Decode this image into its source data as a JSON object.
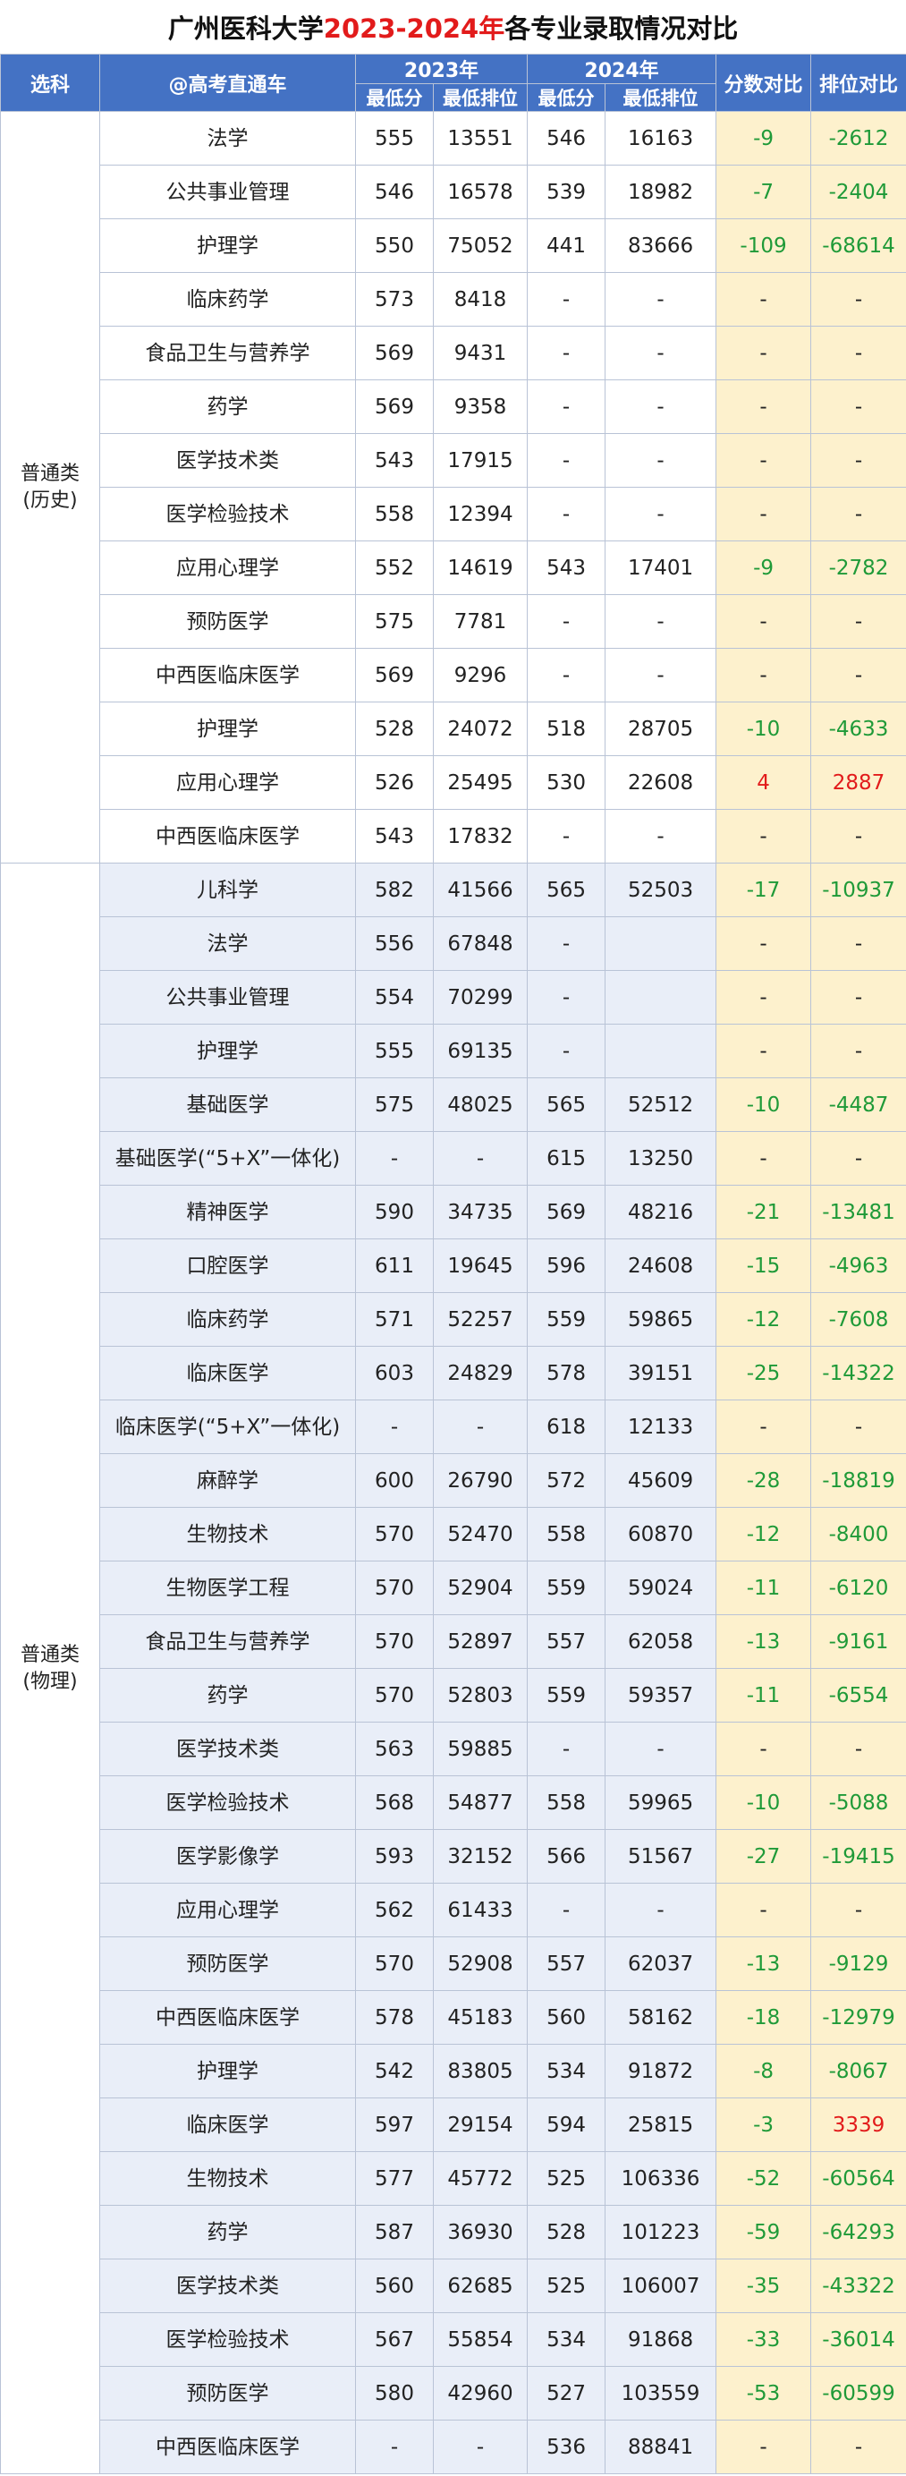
{
  "title": {
    "prefix": "广州医科大学",
    "years": "2023-2024年",
    "suffix": "各专业录取情况对比"
  },
  "header": {
    "category": "选科",
    "major": "@高考直通车",
    "year2023": "2023年",
    "year2024": "2024年",
    "min_score": "最低分",
    "min_rank": "最低排位",
    "score_diff": "分数对比",
    "rank_diff": "排位对比"
  },
  "groups": [
    {
      "category": "普通类\n(历史)",
      "rows": [
        {
          "major": "法学",
          "s23": "555",
          "r23": "13551",
          "s24": "546",
          "r24": "16163",
          "ds": "-9",
          "dr": "-2612"
        },
        {
          "major": "公共事业管理",
          "s23": "546",
          "r23": "16578",
          "s24": "539",
          "r24": "18982",
          "ds": "-7",
          "dr": "-2404"
        },
        {
          "major": "护理学",
          "s23": "550",
          "r23": "75052",
          "s24": "441",
          "r24": "83666",
          "ds": "-109",
          "dr": "-68614"
        },
        {
          "major": "临床药学",
          "s23": "573",
          "r23": "8418",
          "s24": "-",
          "r24": "-",
          "ds": "-",
          "dr": "-"
        },
        {
          "major": "食品卫生与营养学",
          "s23": "569",
          "r23": "9431",
          "s24": "-",
          "r24": "-",
          "ds": "-",
          "dr": "-"
        },
        {
          "major": "药学",
          "s23": "569",
          "r23": "9358",
          "s24": "-",
          "r24": "-",
          "ds": "-",
          "dr": "-"
        },
        {
          "major": "医学技术类",
          "s23": "543",
          "r23": "17915",
          "s24": "-",
          "r24": "-",
          "ds": "-",
          "dr": "-"
        },
        {
          "major": "医学检验技术",
          "s23": "558",
          "r23": "12394",
          "s24": "-",
          "r24": "-",
          "ds": "-",
          "dr": "-"
        },
        {
          "major": "应用心理学",
          "s23": "552",
          "r23": "14619",
          "s24": "543",
          "r24": "17401",
          "ds": "-9",
          "dr": "-2782"
        },
        {
          "major": "预防医学",
          "s23": "575",
          "r23": "7781",
          "s24": "-",
          "r24": "-",
          "ds": "-",
          "dr": "-"
        },
        {
          "major": "中西医临床医学",
          "s23": "569",
          "r23": "9296",
          "s24": "-",
          "r24": "-",
          "ds": "-",
          "dr": "-"
        },
        {
          "major": "护理学",
          "s23": "528",
          "r23": "24072",
          "s24": "518",
          "r24": "28705",
          "ds": "-10",
          "dr": "-4633"
        },
        {
          "major": "应用心理学",
          "s23": "526",
          "r23": "25495",
          "s24": "530",
          "r24": "22608",
          "ds": "4",
          "dr": "2887"
        },
        {
          "major": "中西医临床医学",
          "s23": "543",
          "r23": "17832",
          "s24": "-",
          "r24": "-",
          "ds": "-",
          "dr": "-"
        }
      ]
    },
    {
      "category": "普通类\n(物理)",
      "rows": [
        {
          "major": "儿科学",
          "s23": "582",
          "r23": "41566",
          "s24": "565",
          "r24": "52503",
          "ds": "-17",
          "dr": "-10937"
        },
        {
          "major": "法学",
          "s23": "556",
          "r23": "67848",
          "s24": "-",
          "r24": "",
          "ds": "-",
          "dr": "-"
        },
        {
          "major": "公共事业管理",
          "s23": "554",
          "r23": "70299",
          "s24": "-",
          "r24": "",
          "ds": "-",
          "dr": "-"
        },
        {
          "major": "护理学",
          "s23": "555",
          "r23": "69135",
          "s24": "-",
          "r24": "",
          "ds": "-",
          "dr": "-"
        },
        {
          "major": "基础医学",
          "s23": "575",
          "r23": "48025",
          "s24": "565",
          "r24": "52512",
          "ds": "-10",
          "dr": "-4487"
        },
        {
          "major": "基础医学(“5+X”一体化)",
          "s23": "-",
          "r23": "-",
          "s24": "615",
          "r24": "13250",
          "ds": "-",
          "dr": "-"
        },
        {
          "major": "精神医学",
          "s23": "590",
          "r23": "34735",
          "s24": "569",
          "r24": "48216",
          "ds": "-21",
          "dr": "-13481"
        },
        {
          "major": "口腔医学",
          "s23": "611",
          "r23": "19645",
          "s24": "596",
          "r24": "24608",
          "ds": "-15",
          "dr": "-4963"
        },
        {
          "major": "临床药学",
          "s23": "571",
          "r23": "52257",
          "s24": "559",
          "r24": "59865",
          "ds": "-12",
          "dr": "-7608"
        },
        {
          "major": "临床医学",
          "s23": "603",
          "r23": "24829",
          "s24": "578",
          "r24": "39151",
          "ds": "-25",
          "dr": "-14322"
        },
        {
          "major": "临床医学(“5+X”一体化)",
          "s23": "-",
          "r23": "-",
          "s24": "618",
          "r24": "12133",
          "ds": "-",
          "dr": "-"
        },
        {
          "major": "麻醉学",
          "s23": "600",
          "r23": "26790",
          "s24": "572",
          "r24": "45609",
          "ds": "-28",
          "dr": "-18819"
        },
        {
          "major": "生物技术",
          "s23": "570",
          "r23": "52470",
          "s24": "558",
          "r24": "60870",
          "ds": "-12",
          "dr": "-8400"
        },
        {
          "major": "生物医学工程",
          "s23": "570",
          "r23": "52904",
          "s24": "559",
          "r24": "59024",
          "ds": "-11",
          "dr": "-6120"
        },
        {
          "major": "食品卫生与营养学",
          "s23": "570",
          "r23": "52897",
          "s24": "557",
          "r24": "62058",
          "ds": "-13",
          "dr": "-9161"
        },
        {
          "major": "药学",
          "s23": "570",
          "r23": "52803",
          "s24": "559",
          "r24": "59357",
          "ds": "-11",
          "dr": "-6554"
        },
        {
          "major": "医学技术类",
          "s23": "563",
          "r23": "59885",
          "s24": "-",
          "r24": "-",
          "ds": "-",
          "dr": "-"
        },
        {
          "major": "医学检验技术",
          "s23": "568",
          "r23": "54877",
          "s24": "558",
          "r24": "59965",
          "ds": "-10",
          "dr": "-5088"
        },
        {
          "major": "医学影像学",
          "s23": "593",
          "r23": "32152",
          "s24": "566",
          "r24": "51567",
          "ds": "-27",
          "dr": "-19415"
        },
        {
          "major": "应用心理学",
          "s23": "562",
          "r23": "61433",
          "s24": "-",
          "r24": "-",
          "ds": "-",
          "dr": "-"
        },
        {
          "major": "预防医学",
          "s23": "570",
          "r23": "52908",
          "s24": "557",
          "r24": "62037",
          "ds": "-13",
          "dr": "-9129"
        },
        {
          "major": "中西医临床医学",
          "s23": "578",
          "r23": "45183",
          "s24": "560",
          "r24": "58162",
          "ds": "-18",
          "dr": "-12979"
        },
        {
          "major": "护理学",
          "s23": "542",
          "r23": "83805",
          "s24": "534",
          "r24": "91872",
          "ds": "-8",
          "dr": "-8067"
        },
        {
          "major": "临床医学",
          "s23": "597",
          "r23": "29154",
          "s24": "594",
          "r24": "25815",
          "ds": "-3",
          "dr": "3339"
        },
        {
          "major": "生物技术",
          "s23": "577",
          "r23": "45772",
          "s24": "525",
          "r24": "106336",
          "ds": "-52",
          "dr": "-60564"
        },
        {
          "major": "药学",
          "s23": "587",
          "r23": "36930",
          "s24": "528",
          "r24": "101223",
          "ds": "-59",
          "dr": "-64293"
        },
        {
          "major": "医学技术类",
          "s23": "560",
          "r23": "62685",
          "s24": "525",
          "r24": "106007",
          "ds": "-35",
          "dr": "-43322"
        },
        {
          "major": "医学检验技术",
          "s23": "567",
          "r23": "55854",
          "s24": "534",
          "r24": "91868",
          "ds": "-33",
          "dr": "-36014"
        },
        {
          "major": "预防医学",
          "s23": "580",
          "r23": "42960",
          "s24": "527",
          "r24": "103559",
          "ds": "-53",
          "dr": "-60599"
        },
        {
          "major": "中西医临床医学",
          "s23": "-",
          "r23": "-",
          "s24": "536",
          "r24": "88841",
          "ds": "-",
          "dr": "-"
        }
      ]
    }
  ],
  "colors": {
    "header_bg": "#4472c4",
    "diff_bg": "#fdf1cd",
    "negative": "#1f9a38",
    "positive": "#e21b1b",
    "title_highlight": "#e21b1b"
  }
}
